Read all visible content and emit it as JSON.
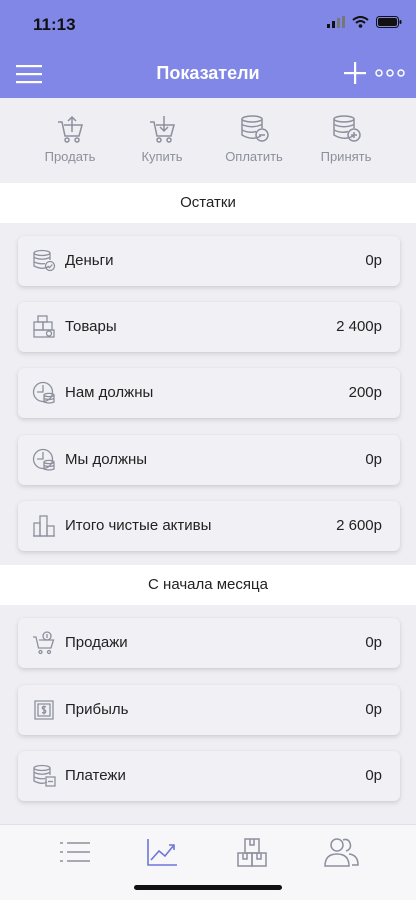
{
  "status": {
    "time": "11:13"
  },
  "nav": {
    "title": "Показатели"
  },
  "actions": [
    {
      "label": "Продать"
    },
    {
      "label": "Купить"
    },
    {
      "label": "Оплатить"
    },
    {
      "label": "Принять"
    }
  ],
  "balances": {
    "title": "Остатки",
    "items": [
      {
        "label": "Деньги",
        "value": "0р",
        "icon": "coins-check-icon"
      },
      {
        "label": "Товары",
        "value": "2 400р",
        "icon": "goods-boxes-icon"
      },
      {
        "label": "Нам должны",
        "value": "200р",
        "icon": "clock-coins-icon"
      },
      {
        "label": "Мы должны",
        "value": "0р",
        "icon": "clock-coins-icon"
      },
      {
        "label": "Итого чистые активы",
        "value": "2 600р",
        "icon": "buildings-icon"
      }
    ]
  },
  "month": {
    "title": "С начала месяца",
    "items": [
      {
        "label": "Продажи",
        "value": "0р",
        "icon": "cart-coin-icon"
      },
      {
        "label": "Прибыль",
        "value": "0р",
        "icon": "dollar-note-icon"
      },
      {
        "label": "Платежи",
        "value": "0р",
        "icon": "coins-minus-icon"
      }
    ]
  },
  "colors": {
    "accent": "#8187e6",
    "icon": "#8d8f9d",
    "active_tab": "#6f76d9"
  }
}
